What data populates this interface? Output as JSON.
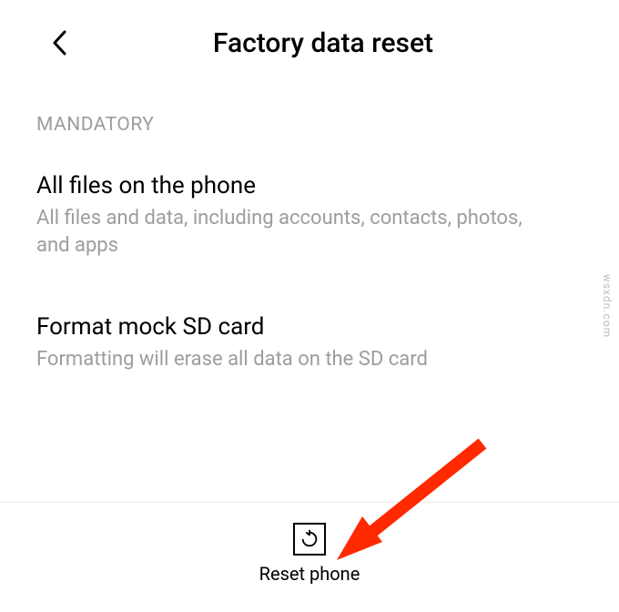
{
  "header": {
    "title": "Factory data reset"
  },
  "section": {
    "label": "MANDATORY"
  },
  "items": [
    {
      "title": "All files on the phone",
      "desc": "All files and data, including accounts, contacts, photos, and apps"
    },
    {
      "title": "Format mock SD card",
      "desc": "Formatting will erase all data on the SD card"
    }
  ],
  "footer": {
    "reset_label": "Reset phone"
  },
  "watermark": "wsxdn.com",
  "annotation": {
    "arrow_color": "#ff2a00"
  }
}
